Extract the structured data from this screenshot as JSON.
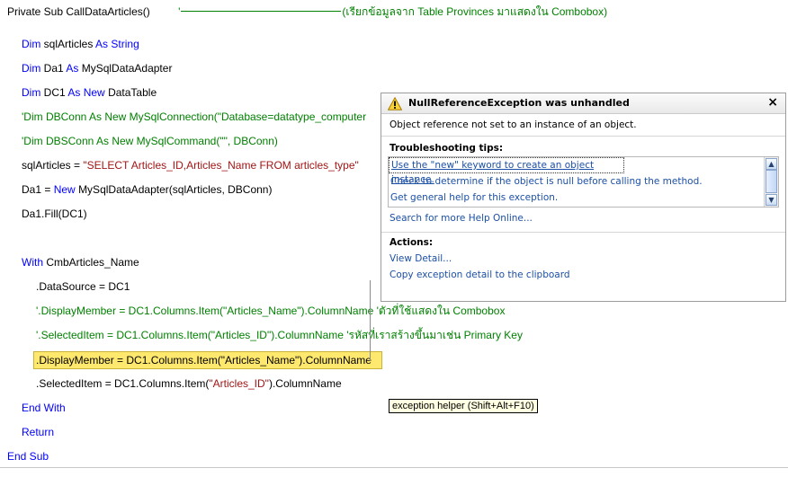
{
  "code": {
    "sub_decl_kw": "Private Sub",
    "sub_name": "CallDataArticles()",
    "sub_comment_tick": "'",
    "sub_comment": "(เรียกข้อมูลจาก Table Provinces มาแสดงใน Combobox)",
    "dim1_kw": "Dim",
    "dim1_name": "sqlArticles",
    "dim1_as": "As",
    "dim1_type": "String",
    "dim2_kw": "Dim",
    "dim2_name": "Da1",
    "dim2_as": "As",
    "dim2_type": "MySqlDataAdapter",
    "dim3_kw": "Dim",
    "dim3_name": "DC1",
    "dim3_as": "As",
    "dim3_new": "New",
    "dim3_type": "DataTable",
    "comment_dbconn": "'Dim DBConn As New MySqlConnection(\"Database=datatype_computer",
    "comment_dbsconn": "'Dim DBSConn As New MySqlCommand(\"\", DBConn)",
    "sql_assign_lhs": "sqlArticles =",
    "sql_assign_str": "\"SELECT Articles_ID,Articles_Name FROM articles_type\"",
    "da_assign_lhs": "Da1 =",
    "da_assign_new": "New",
    "da_assign_rhs": "MySqlDataAdapter(sqlArticles, DBConn)",
    "fill_line": "Da1.Fill(DC1)",
    "with_kw": "With",
    "with_target": "CmbArticles_Name",
    "datasource_line": ".DataSource = DC1",
    "comment_display": "'.DisplayMember = DC1.Columns.Item(\"Articles_Name\").ColumnName  'ตัวที่ใช้แสดงใน Combobox",
    "comment_selected": "'.SelectedItem = DC1.Columns.Item(\"Articles_ID\").ColumnName 'รหัสที่เราสร้างขึ้นมาเช่น Primary Key",
    "display_line": ".DisplayMember = DC1.Columns.Item(\"Articles_Name\").ColumnName",
    "selected_pre": ".SelectedItem = DC1.Columns.Item(",
    "selected_str": "\"Articles_ID\"",
    "selected_post": ").ColumnName",
    "end_with": "End With",
    "return_kw": "Return",
    "end_sub": "End Sub"
  },
  "exception": {
    "title": "NullReferenceException was unhandled",
    "message": "Object reference not set to an instance of an object.",
    "tips_title": "Troubleshooting tips:",
    "tips": [
      "Use the \"new\" keyword to create an object instance.",
      "Check to determine if the object is null before calling the method.",
      "Get general help for this exception."
    ],
    "search_link": "Search for more Help Online...",
    "actions_title": "Actions:",
    "actions": [
      "View Detail...",
      "Copy exception detail to the clipboard"
    ],
    "close_glyph": "×"
  },
  "helper_tooltip": "exception helper (Shift+Alt+F10)",
  "colors": {
    "keyword": "#0000ff",
    "string": "#a31515",
    "comment": "#008000",
    "highlight": "#ffe86e",
    "link": "#1b4fa5"
  }
}
